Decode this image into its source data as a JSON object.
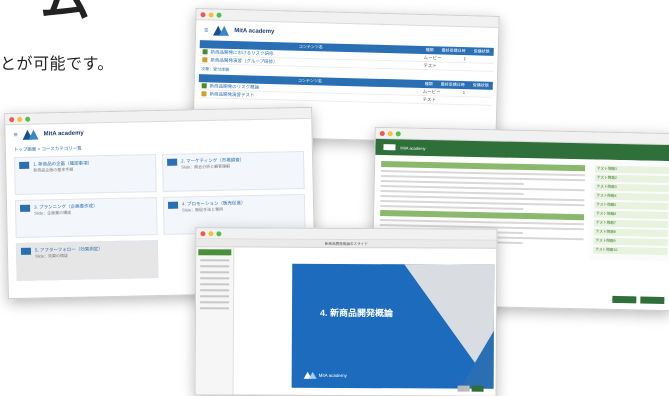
{
  "headline": {
    "big_char": "ム",
    "caption": "とが可能です。"
  },
  "brand": {
    "name": "MitA academy"
  },
  "window_1": {
    "table1": {
      "headers": [
        "コンテンツ名",
        "種類",
        "最終受講日時",
        "受講状態"
      ],
      "rows": [
        {
          "title": "新商品開発におけるリスク研修",
          "type": "ムービー",
          "status": "1"
        },
        {
          "title": "新商品開発演習（グループ研修）",
          "type": "テスト",
          "status": ""
        }
      ]
    },
    "section_label": "次章：受付体験",
    "table2": {
      "headers": [
        "コンテンツ名",
        "種類",
        "最終受講日時",
        "受講状態"
      ],
      "rows": [
        {
          "title": "新商品開発のリスク概論",
          "type": "ムービー",
          "status": "1"
        },
        {
          "title": "新商品開発演習テスト",
          "type": "テスト",
          "status": ""
        }
      ]
    }
  },
  "window_2": {
    "breadcrumb": "トップ画面 > コースカテゴリ一覧",
    "courses": [
      {
        "title": "1. 新商品の企画（確認事項）",
        "sub": "新商品企画の基本手順",
        "gray": false
      },
      {
        "title": "2. マーケティング（市場調査）",
        "sub": "Slide：競合分析と顧客理解",
        "gray": false
      },
      {
        "title": "3. プランニング（企画書作成）",
        "sub": "Slide：企画書の構成",
        "gray": false
      },
      {
        "title": "4. プロモーション（販売促進）",
        "sub": "Slide：販促手法と事例",
        "gray": false
      },
      {
        "title": "5. アフターフォロー（効果測定）",
        "sub": "Slide：効果の検証",
        "gray": true
      }
    ]
  },
  "window_3": {
    "side_links": [
      "テスト問題1",
      "テスト問題2",
      "テスト問題3",
      "テスト問題4",
      "テスト問題5",
      "テスト問題6",
      "テスト問題7",
      "テスト問題8",
      "テスト問題9",
      "テスト問題10"
    ]
  },
  "window_4": {
    "bar_title": "新商品開発概論のスライド",
    "slide_title": "4. 新商品開発概論"
  },
  "colors": {
    "brand_blue": "#1c6bbd",
    "table_blue": "#2a6fb3",
    "doc_green": "#2f6f3a",
    "light_green": "#8ab86c"
  }
}
